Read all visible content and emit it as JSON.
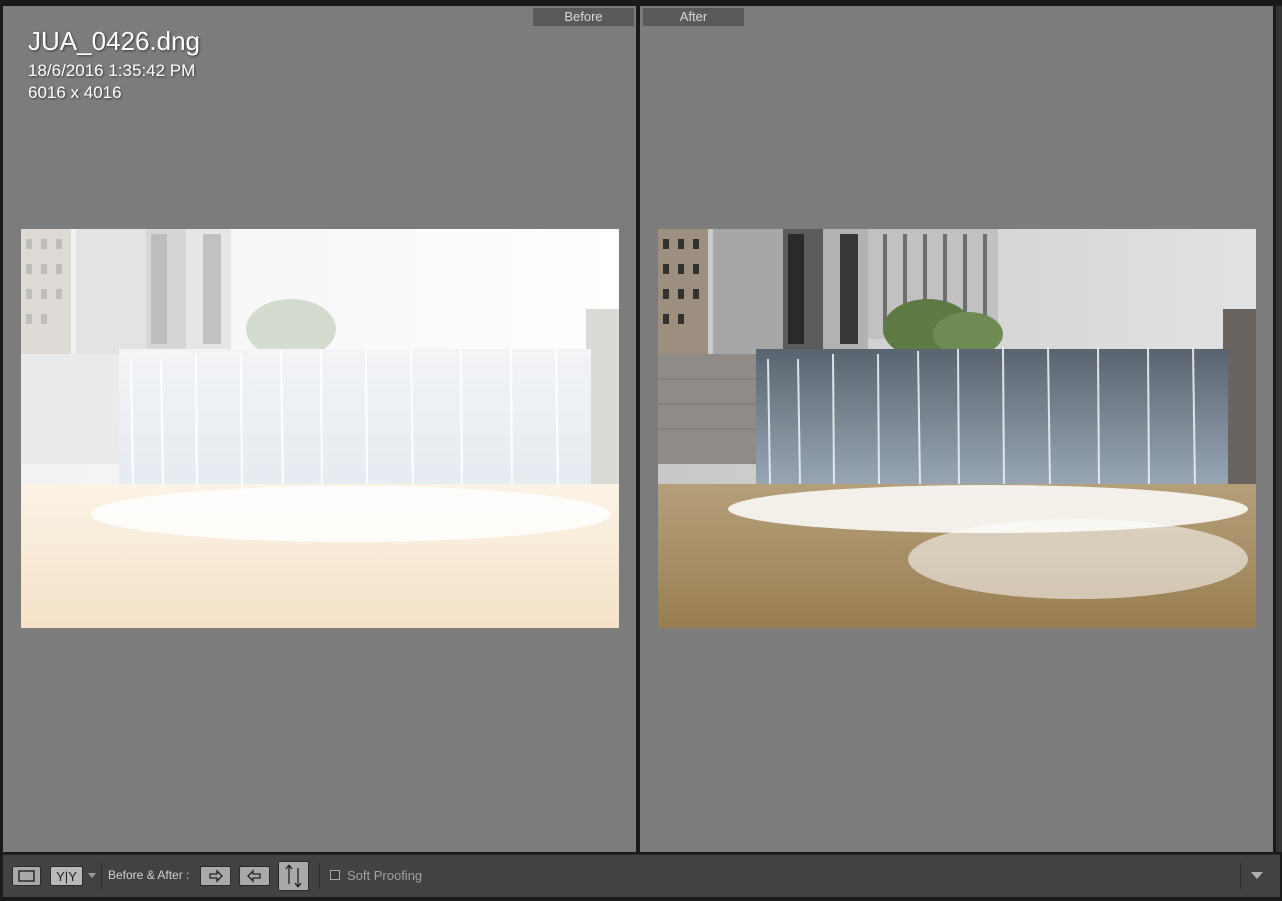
{
  "before_pane": {
    "tab_label": "Before",
    "filename": "JUA_0426.dng",
    "datetime": "18/6/2016 1:35:42 PM",
    "dimensions": "6016 x 4016"
  },
  "after_pane": {
    "tab_label": "After"
  },
  "toolbar": {
    "view_mode_icon": "single-view-icon",
    "compare_mode_label": "Y|Y",
    "before_after_label": "Before & After :",
    "copy_before_to_after_icon": "arrow-right-icon",
    "copy_after_to_before_icon": "arrow-left-icon",
    "swap_icon": "swap-arrows-icon",
    "soft_proofing_label": "Soft Proofing",
    "soft_proofing_checked": false,
    "toolbar_menu_icon": "chevron-down-icon"
  },
  "colors": {
    "pane_bg": "#7c7c7c",
    "toolbar_bg": "#424242",
    "tab_bg": "#5a5a5a"
  }
}
